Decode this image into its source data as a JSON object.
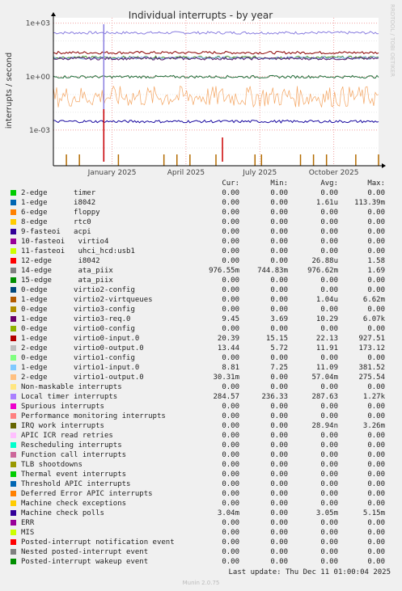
{
  "chart_data": {
    "type": "line",
    "title": "Individual interrupts - by year",
    "ylabel": "interrupts / second",
    "side_label": "RRDTOOL / TOBI OETIKER",
    "y_scale": "log",
    "ylim": [
      1e-05,
      2000
    ],
    "y_ticks": [
      {
        "label": "1e+03",
        "value": 1000
      },
      {
        "label": "1e+00",
        "value": 1
      },
      {
        "label": "1e-03",
        "value": 0.001
      }
    ],
    "x_ticks": [
      "January 2025",
      "April 2025",
      "July 2025",
      "October 2025"
    ],
    "grid": true,
    "series": [
      {
        "name": "Local timer interrupts",
        "color": "#8a7ee0",
        "level": 287.63
      },
      {
        "name": "virtio0-input.0",
        "color": "#8b0000",
        "level": 22.13
      },
      {
        "name": "virtio0-output.0",
        "color": "#3b8c24",
        "level": 11.91
      },
      {
        "name": "virtio1-input.0",
        "color": "#7fb0e8",
        "level": 11.09
      },
      {
        "name": "virtio3-req.0",
        "color": "#5a1a6e",
        "level": 10.29
      },
      {
        "name": "ata_piix",
        "color": "#1f6e3a",
        "level": 0.97662
      },
      {
        "name": "virtio1-output.0",
        "color": "#f4a460",
        "level": 0.05704
      },
      {
        "name": "Machine check polls",
        "color": "#1a0aa0",
        "level": 0.00305
      },
      {
        "name": "12-edge i8042",
        "color": "#cc0000",
        "level": 2.688e-05
      },
      {
        "name": "IRQ work interrupts",
        "color": "#806000",
        "level": 2.89e-08
      }
    ]
  },
  "legend": {
    "headers": [
      "Cur:",
      "Min:",
      "Avg:",
      "Max:"
    ],
    "rows": [
      {
        "label": "2-edge      timer",
        "color": "#00cc00",
        "cur": "0.00",
        "min": "0.00",
        "avg": "0.00",
        "max": "0.00"
      },
      {
        "label": "1-edge      i8042",
        "color": "#0066b3",
        "cur": "0.00",
        "min": "0.00",
        "avg": "1.61u",
        "max": "113.39m"
      },
      {
        "label": "6-edge      floppy",
        "color": "#ff8000",
        "cur": "0.00",
        "min": "0.00",
        "avg": "0.00",
        "max": "0.00"
      },
      {
        "label": "8-edge      rtc0",
        "color": "#ffcc00",
        "cur": "0.00",
        "min": "0.00",
        "avg": "0.00",
        "max": "0.00"
      },
      {
        "label": "9-fasteoi   acpi",
        "color": "#330099",
        "cur": "0.00",
        "min": "0.00",
        "avg": "0.00",
        "max": "0.00"
      },
      {
        "label": "10-fasteoi   virtio4",
        "color": "#990099",
        "cur": "0.00",
        "min": "0.00",
        "avg": "0.00",
        "max": "0.00"
      },
      {
        "label": "11-fasteoi   uhci_hcd:usb1",
        "color": "#ccff00",
        "cur": "0.00",
        "min": "0.00",
        "avg": "0.00",
        "max": "0.00"
      },
      {
        "label": "12-edge      i8042",
        "color": "#ff0000",
        "cur": "0.00",
        "min": "0.00",
        "avg": "26.88u",
        "max": "1.58"
      },
      {
        "label": "14-edge      ata_piix",
        "color": "#808080",
        "cur": "976.55m",
        "min": "744.83m",
        "avg": "976.62m",
        "max": "1.69"
      },
      {
        "label": "15-edge      ata_piix",
        "color": "#008f00",
        "cur": "0.00",
        "min": "0.00",
        "avg": "0.00",
        "max": "0.00"
      },
      {
        "label": "0-edge      virtio2-config",
        "color": "#00487d",
        "cur": "0.00",
        "min": "0.00",
        "avg": "0.00",
        "max": "0.00"
      },
      {
        "label": "1-edge      virtio2-virtqueues",
        "color": "#b35a00",
        "cur": "0.00",
        "min": "0.00",
        "avg": "1.04u",
        "max": "6.62m"
      },
      {
        "label": "0-edge      virtio3-config",
        "color": "#b38f00",
        "cur": "0.00",
        "min": "0.00",
        "avg": "0.00",
        "max": "0.00"
      },
      {
        "label": "1-edge      virtio3-req.0",
        "color": "#6b006b",
        "cur": "9.45",
        "min": "3.69",
        "avg": "10.29",
        "max": "6.07k"
      },
      {
        "label": "0-edge      virtio0-config",
        "color": "#8fb300",
        "cur": "0.00",
        "min": "0.00",
        "avg": "0.00",
        "max": "0.00"
      },
      {
        "label": "1-edge      virtio0-input.0",
        "color": "#b30000",
        "cur": "20.39",
        "min": "15.15",
        "avg": "22.13",
        "max": "927.51"
      },
      {
        "label": "2-edge      virtio0-output.0",
        "color": "#bebebe",
        "cur": "13.44",
        "min": "5.72",
        "avg": "11.91",
        "max": "173.12"
      },
      {
        "label": "0-edge      virtio1-config",
        "color": "#80ff80",
        "cur": "0.00",
        "min": "0.00",
        "avg": "0.00",
        "max": "0.00"
      },
      {
        "label": "1-edge      virtio1-input.0",
        "color": "#80c9ff",
        "cur": "8.81",
        "min": "7.25",
        "avg": "11.09",
        "max": "381.52"
      },
      {
        "label": "2-edge      virtio1-output.0",
        "color": "#ffc080",
        "cur": "30.31m",
        "min": "0.00",
        "avg": "57.04m",
        "max": "275.54"
      },
      {
        "label": "Non-maskable interrupts",
        "color": "#ffe680",
        "cur": "0.00",
        "min": "0.00",
        "avg": "0.00",
        "max": "0.00"
      },
      {
        "label": "Local timer interrupts",
        "color": "#aa80ff",
        "cur": "284.57",
        "min": "236.33",
        "avg": "287.63",
        "max": "1.27k"
      },
      {
        "label": "Spurious interrupts",
        "color": "#ee00cc",
        "cur": "0.00",
        "min": "0.00",
        "avg": "0.00",
        "max": "0.00"
      },
      {
        "label": "Performance monitoring interrupts",
        "color": "#ff8080",
        "cur": "0.00",
        "min": "0.00",
        "avg": "0.00",
        "max": "0.00"
      },
      {
        "label": "IRQ work interrupts",
        "color": "#666600",
        "cur": "0.00",
        "min": "0.00",
        "avg": "28.94n",
        "max": "3.26m"
      },
      {
        "label": "APIC ICR read retries",
        "color": "#ffbfff",
        "cur": "0.00",
        "min": "0.00",
        "avg": "0.00",
        "max": "0.00"
      },
      {
        "label": "Rescheduling interrupts",
        "color": "#00ffcc",
        "cur": "0.00",
        "min": "0.00",
        "avg": "0.00",
        "max": "0.00"
      },
      {
        "label": "Function call interrupts",
        "color": "#cc6699",
        "cur": "0.00",
        "min": "0.00",
        "avg": "0.00",
        "max": "0.00"
      },
      {
        "label": "TLB shootdowns",
        "color": "#999900",
        "cur": "0.00",
        "min": "0.00",
        "avg": "0.00",
        "max": "0.00"
      },
      {
        "label": "Thermal event interrupts",
        "color": "#00cc00",
        "cur": "0.00",
        "min": "0.00",
        "avg": "0.00",
        "max": "0.00"
      },
      {
        "label": "Threshold APIC interrupts",
        "color": "#0066b3",
        "cur": "0.00",
        "min": "0.00",
        "avg": "0.00",
        "max": "0.00"
      },
      {
        "label": "Deferred Error APIC interrupts",
        "color": "#ff8000",
        "cur": "0.00",
        "min": "0.00",
        "avg": "0.00",
        "max": "0.00"
      },
      {
        "label": "Machine check exceptions",
        "color": "#ffcc00",
        "cur": "0.00",
        "min": "0.00",
        "avg": "0.00",
        "max": "0.00"
      },
      {
        "label": "Machine check polls",
        "color": "#330099",
        "cur": "3.04m",
        "min": "0.00",
        "avg": "3.05m",
        "max": "5.15m"
      },
      {
        "label": "ERR",
        "color": "#990099",
        "cur": "0.00",
        "min": "0.00",
        "avg": "0.00",
        "max": "0.00"
      },
      {
        "label": "MIS",
        "color": "#ccff00",
        "cur": "0.00",
        "min": "0.00",
        "avg": "0.00",
        "max": "0.00"
      },
      {
        "label": "Posted-interrupt notification event",
        "color": "#ff0000",
        "cur": "0.00",
        "min": "0.00",
        "avg": "0.00",
        "max": "0.00"
      },
      {
        "label": "Nested posted-interrupt event",
        "color": "#808080",
        "cur": "0.00",
        "min": "0.00",
        "avg": "0.00",
        "max": "0.00"
      },
      {
        "label": "Posted-interrupt wakeup event",
        "color": "#008f00",
        "cur": "0.00",
        "min": "0.00",
        "avg": "0.00",
        "max": "0.00"
      }
    ]
  },
  "footer": {
    "last_update": "Last update: Thu Dec 11 01:00:04 2025",
    "munin_version": "Munin 2.0.75"
  }
}
